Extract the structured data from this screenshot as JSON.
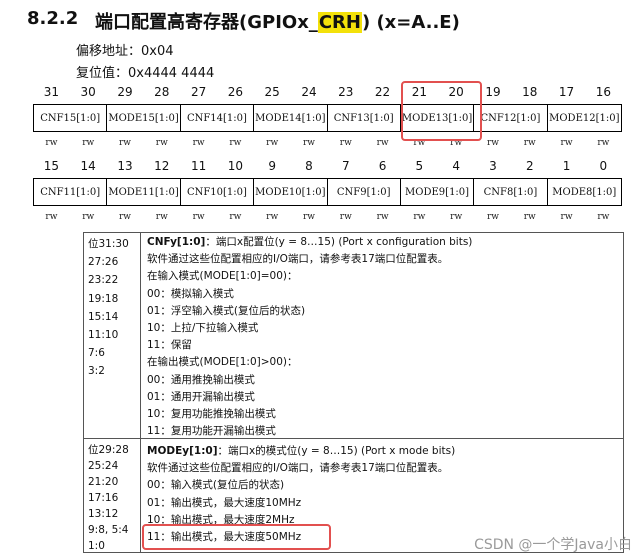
{
  "heading": {
    "number": "8.2.2",
    "title_prefix": "端口配置高寄存器(GPIOx_",
    "title_highlight": "CRH",
    "title_suffix": ") (x=A..E)"
  },
  "info": {
    "offset": "偏移地址：0x04",
    "reset": "复位值：0x4444 4444"
  },
  "bits_top": [
    "31",
    "30",
    "29",
    "28",
    "27",
    "26",
    "25",
    "24",
    "23",
    "22",
    "21",
    "20",
    "19",
    "18",
    "17",
    "16"
  ],
  "bits_bottom": [
    "15",
    "14",
    "13",
    "12",
    "11",
    "10",
    "9",
    "8",
    "7",
    "6",
    "5",
    "4",
    "3",
    "2",
    "1",
    "0"
  ],
  "fields_top": [
    "CNF15[1:0]",
    "MODE15[1:0]",
    "CNF14[1:0]",
    "MODE14[1:0]",
    "CNF13[1:0]",
    "MODE13[1:0]",
    "CNF12[1:0]",
    "MODE12[1:0]"
  ],
  "fields_bottom": [
    "CNF11[1:0]",
    "MODE11[1:0]",
    "CNF10[1:0]",
    "MODE10[1:0]",
    "CNF9[1:0]",
    "MODE9[1:0]",
    "CNF8[1:0]",
    "MODE8[1:0]"
  ],
  "rw": "rw",
  "cnf_section": {
    "bits": [
      "位31:30",
      "27:26",
      "23:22",
      "19:18",
      "15:14",
      "11:10",
      "7:6",
      "3:2"
    ],
    "title_name": "CNFy[1:0]",
    "title_desc": "：端口x配置位(y = 8…15) (Port x configuration bits)",
    "lines": [
      "软件通过这些位配置相应的I/O端口，请参考表17端口位配置表。",
      "在输入模式(MODE[1:0]=00)：",
      "00：模拟输入模式",
      "01：浮空输入模式(复位后的状态)",
      "10：上拉/下拉输入模式",
      "11：保留",
      "在输出模式(MODE[1:0]>00)：",
      "00：通用推挽输出模式",
      "01：通用开漏输出模式",
      "10：复用功能推挽输出模式",
      "11：复用功能开漏输出模式"
    ]
  },
  "mode_section": {
    "bits": [
      "位29:28",
      "25:24",
      "21:20",
      "17:16",
      "13:12",
      "9:8, 5:4",
      "1:0"
    ],
    "title_name": "MODEy[1:0]",
    "title_desc": "：端口x的模式位(y = 8…15) (Port x mode bits)",
    "lines": [
      "软件通过这些位配置相应的I/O端口，请参考表17端口位配置表。",
      "00：输入模式(复位后的状态)",
      "01：输出模式，最大速度10MHz",
      "10：输出模式，最大速度2MHz",
      "11：输出模式，最大速度50MHz"
    ]
  },
  "watermark": "CSDN @一个学Java小白",
  "colors": {
    "highlight": "#f3e10a",
    "annotation_box": "#e2504f"
  }
}
